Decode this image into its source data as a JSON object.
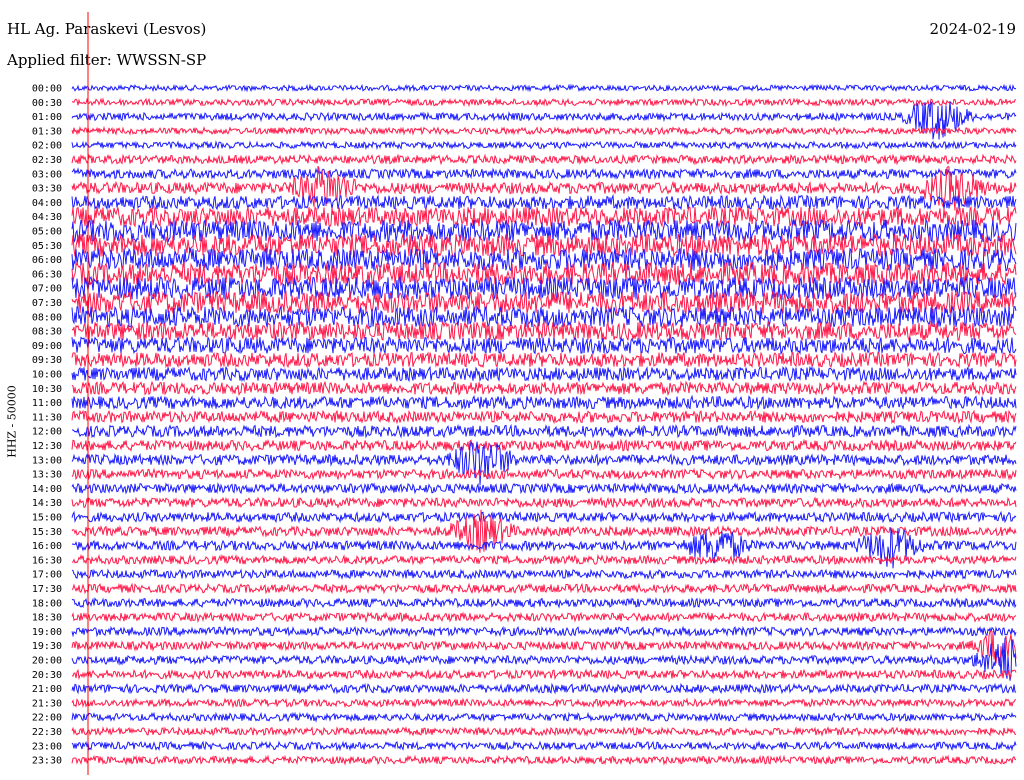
{
  "header": {
    "station": "HL Ag. Paraskevi (Lesvos)",
    "date": "2024-02-19",
    "filter": "Applied filter: WWSSN-SP"
  },
  "axis": {
    "y_label": "HHZ - 50000"
  },
  "colors": {
    "blue": "#1a1aff",
    "red": "#ff1a4a",
    "marker": "#ff0000"
  },
  "chart_data": {
    "type": "line",
    "title": "HL Ag. Paraskevi (Lesvos)",
    "xlabel": "",
    "ylabel": "HHZ - 50000",
    "trace_times": [
      "00:00",
      "00:30",
      "01:00",
      "01:30",
      "02:00",
      "02:30",
      "03:00",
      "03:30",
      "04:00",
      "04:30",
      "05:00",
      "05:30",
      "06:00",
      "06:30",
      "07:00",
      "07:30",
      "08:00",
      "08:30",
      "09:00",
      "09:30",
      "10:00",
      "10:30",
      "11:00",
      "11:30",
      "12:00",
      "12:30",
      "13:00",
      "13:30",
      "14:00",
      "14:30",
      "15:00",
      "15:30",
      "16:00",
      "16:30",
      "17:00",
      "17:30",
      "18:00",
      "18:30",
      "19:00",
      "19:30",
      "20:00",
      "20:30",
      "21:00",
      "21:30",
      "22:00",
      "22:30",
      "23:00",
      "23:30"
    ],
    "trace_colors": [
      "blue",
      "red"
    ],
    "x_range_minutes": [
      0,
      30
    ],
    "amplitude_relative": [
      0.15,
      0.2,
      0.25,
      0.2,
      0.2,
      0.3,
      0.35,
      0.45,
      0.55,
      0.85,
      1.0,
      1.0,
      1.0,
      1.0,
      1.0,
      1.0,
      0.9,
      0.8,
      0.7,
      0.6,
      0.55,
      0.5,
      0.5,
      0.45,
      0.45,
      0.4,
      0.4,
      0.35,
      0.35,
      0.35,
      0.35,
      0.35,
      0.35,
      0.3,
      0.3,
      0.3,
      0.3,
      0.3,
      0.3,
      0.3,
      0.3,
      0.3,
      0.3,
      0.25,
      0.25,
      0.25,
      0.25,
      0.25
    ],
    "events": [
      {
        "trace": "01:00",
        "minute": 27.5,
        "strength": 1.0
      },
      {
        "trace": "03:30",
        "minute": 8.0,
        "strength": 0.9
      },
      {
        "trace": "03:30",
        "minute": 28.0,
        "strength": 0.9
      },
      {
        "trace": "13:00",
        "minute": 13.0,
        "strength": 1.0
      },
      {
        "trace": "15:30",
        "minute": 13.0,
        "strength": 0.8
      },
      {
        "trace": "16:00",
        "minute": 20.5,
        "strength": 0.8
      },
      {
        "trace": "16:00",
        "minute": 26.0,
        "strength": 0.9
      },
      {
        "trace": "19:30",
        "minute": 29.7,
        "strength": 1.0
      },
      {
        "trace": "20:00",
        "minute": 29.7,
        "strength": 1.0
      }
    ],
    "grid": false,
    "legend": "none"
  }
}
